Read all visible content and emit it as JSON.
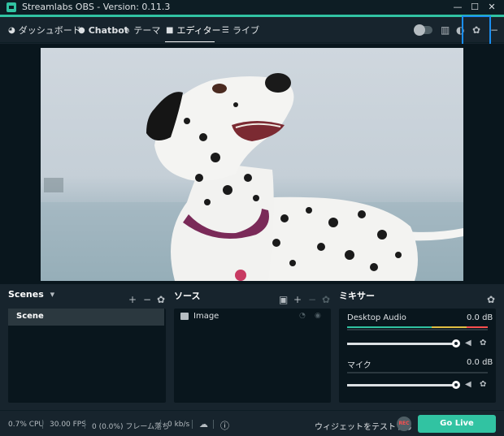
{
  "window": {
    "title": "Streamlabs OBS - Version: 0.11.3",
    "minimize_glyph": "—",
    "maximize_glyph": "☐",
    "close_glyph": "✕"
  },
  "nav": {
    "items": [
      {
        "label": "ダッシュボード",
        "icon": "dashboard-icon",
        "glyph": "◕"
      },
      {
        "label": "Chatbot",
        "icon": "chatbot-icon",
        "glyph": "●"
      },
      {
        "label": "テーマ",
        "icon": "themes-icon",
        "glyph": "✎"
      },
      {
        "label": "エディター",
        "icon": "editor-icon",
        "glyph": "■",
        "active": true
      },
      {
        "label": "ライブ",
        "icon": "live-icon",
        "glyph": "☰"
      }
    ]
  },
  "scenes": {
    "title": "Scenes",
    "dropdown_glyph": "▾",
    "add_glyph": "+",
    "remove_glyph": "−",
    "settings_glyph": "✿",
    "items": [
      "Scene"
    ]
  },
  "sources": {
    "title": "ソース",
    "folder_glyph": "▣",
    "add_glyph": "+",
    "remove_glyph": "−",
    "settings_glyph": "✿",
    "items": [
      "Image"
    ],
    "lock_glyph": "◔",
    "visible_glyph": "◉"
  },
  "mixer": {
    "title": "ミキサー",
    "settings_glyph": "✿",
    "channels": [
      {
        "name": "Desktop Audio",
        "db": "0.0 dB",
        "level": 1.0,
        "muted": true
      },
      {
        "name": "マイク",
        "db": "0.0 dB",
        "level": 1.0,
        "muted": false
      }
    ],
    "mute_glyph": "◀",
    "gear_glyph": "✿"
  },
  "footer": {
    "cpu": "0.7% CPU",
    "fps": "30.00 FPS",
    "dropped": "0 (0.0%) フレーム落ち",
    "bandwidth": "0 kb/s",
    "cloud_glyph": "☁",
    "info_glyph": "ⓘ",
    "test_widgets": "ウィジェットをテストする",
    "rec": "REC",
    "go_live": "Go Live"
  },
  "colors": {
    "accent": "#31c3a2",
    "highlight": "#1a8ef0",
    "rec": "#fb4f4f"
  }
}
